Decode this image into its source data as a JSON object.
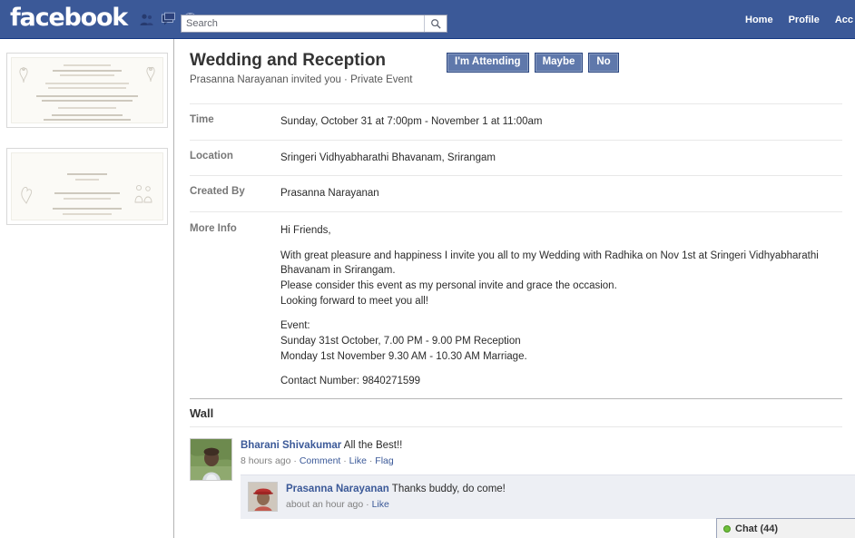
{
  "header": {
    "logo": "facebook",
    "icons": [
      {
        "name": "friend-requests-icon",
        "label": "Friend Requests"
      },
      {
        "name": "messages-icon",
        "label": "Messages"
      },
      {
        "name": "notifications-icon",
        "label": "Notifications"
      }
    ],
    "search": {
      "placeholder": "Search",
      "value": "",
      "button_icon": "search-icon"
    },
    "nav": [
      {
        "label": "Home"
      },
      {
        "label": "Profile"
      },
      {
        "label": "Acc"
      }
    ]
  },
  "sidebar": {
    "photos": [
      {
        "name": "wedding-invitation-card-front",
        "caption": ""
      },
      {
        "name": "wedding-invitation-card-programme",
        "caption": ""
      }
    ]
  },
  "event": {
    "title": "Wedding and Reception",
    "subtitle": "Prasanna Narayanan invited you · Private Event",
    "rsvp_buttons": [
      {
        "label": "I'm Attending"
      },
      {
        "label": "Maybe"
      },
      {
        "label": "No"
      }
    ],
    "details": [
      {
        "label": "Time",
        "value": "Sunday, October 31 at 7:00pm - November 1 at 11:00am"
      },
      {
        "label": "Location",
        "value": "Sringeri Vidhyabharathi Bhavanam, Srirangam"
      },
      {
        "label": "Created By",
        "value": "Prasanna Narayanan"
      }
    ],
    "more_info_label": "More Info",
    "more_info": [
      "Hi Friends,",
      "With great pleasure and happiness I invite you all to my Wedding with Radhika on Nov 1st at Sringeri Vidhyabharathi Bhavanam in Srirangam.\nPlease consider this event as my personal invite and grace the occasion.\nLooking forward to meet you all!",
      "Event:\nSunday 31st October, 7.00 PM - 9.00 PM Reception\nMonday 1st November 9.30 AM - 10.30 AM Marriage.",
      "Contact Number: 9840271599"
    ]
  },
  "wall": {
    "title": "Wall",
    "posts": [
      {
        "author": "Bharani Shivakumar",
        "text": "All the Best!!",
        "timestamp": "8 hours ago",
        "actions": [
          "Comment",
          "Like",
          "Flag"
        ],
        "reply": {
          "author": "Prasanna Narayanan",
          "text": "Thanks buddy, do come!",
          "timestamp": "about an hour ago",
          "actions": [
            "Like"
          ]
        }
      }
    ]
  },
  "chat": {
    "label": "Chat (44)",
    "status": "online"
  },
  "colors": {
    "facebook_blue": "#3b5998",
    "button_blue": "#5f78ab",
    "button_border": "#29447e",
    "link_blue": "#3b5998",
    "online_green": "#6fbf3a",
    "reply_background": "#edeff4"
  }
}
